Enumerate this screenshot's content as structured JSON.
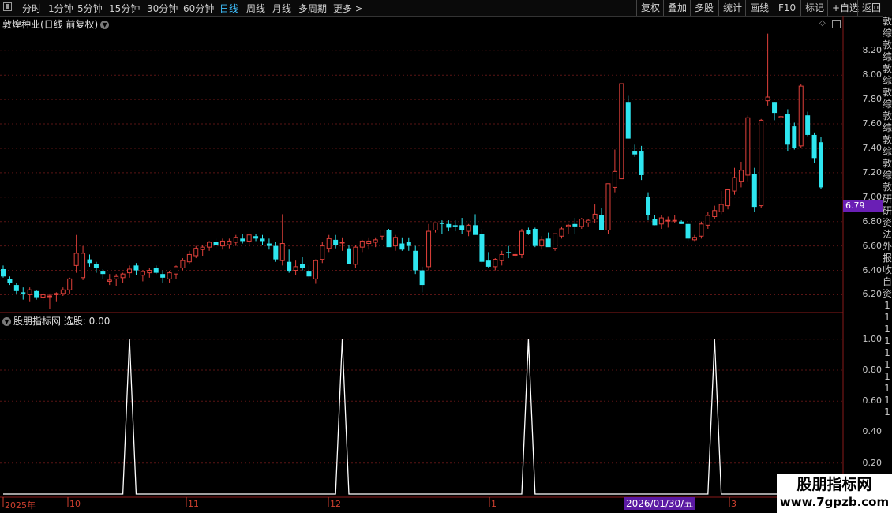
{
  "toolbar": {
    "periods": [
      {
        "label": "分时",
        "active": false
      },
      {
        "label": "1分钟",
        "active": false
      },
      {
        "label": "5分钟",
        "active": false
      },
      {
        "label": "15分钟",
        "active": false
      },
      {
        "label": "30分钟",
        "active": false
      },
      {
        "label": "60分钟",
        "active": false
      },
      {
        "label": "日线",
        "active": true
      },
      {
        "label": "周线",
        "active": false
      },
      {
        "label": "月线",
        "active": false
      },
      {
        "label": "多周期",
        "active": false
      },
      {
        "label": "更多 >",
        "active": false
      }
    ],
    "right": [
      "复权",
      "叠加",
      "多股",
      "统计",
      "画线",
      "F10",
      "标记",
      "+自选",
      "返回"
    ]
  },
  "main": {
    "title": "敦煌种业(日线 前复权)",
    "yticks": [
      "8.20",
      "8.00",
      "7.80",
      "7.60",
      "7.40",
      "7.20",
      "7.00",
      "6.80",
      "6.60",
      "6.40",
      "6.20"
    ],
    "last_price": "6.79",
    "colors": {
      "up": "#e0403a",
      "down": "#2ee6f0",
      "grid": "#5a1414",
      "accent": "#6a1fb5"
    }
  },
  "indicator": {
    "title": "股朋指标网 选股: 0.00",
    "yticks": [
      "1.00",
      "0.80",
      "0.60",
      "0.40",
      "0.20"
    ]
  },
  "xaxis": {
    "ticks": [
      "2025年",
      "10",
      "11",
      "12",
      "1",
      "3"
    ],
    "selected_date": "2026/01/30/五"
  },
  "side_chars": [
    "敦",
    "综",
    "敦",
    "综",
    "敦",
    "综",
    "敦",
    "综",
    "敦",
    "综",
    "敦",
    "综",
    "敦",
    "综",
    "敦",
    "研",
    "研",
    "资",
    "法",
    "外",
    "报",
    "收",
    "",
    "",
    "",
    "",
    "",
    "",
    "自",
    "资",
    "1",
    "1",
    "1",
    "1",
    "1",
    "1",
    "1",
    "1",
    "1",
    "1"
  ],
  "watermark": {
    "line1": "股朋指标网",
    "line2": "www.7gpzb.com"
  },
  "chart_data": [
    {
      "type": "candlestick",
      "title": "敦煌种业(日线 前复权)",
      "ylim": [
        6.08,
        8.37
      ],
      "yticks": [
        8.2,
        8.0,
        7.8,
        7.6,
        7.4,
        7.2,
        7.0,
        6.8,
        6.6,
        6.4,
        6.2
      ],
      "ohlc": [
        [
          6.41,
          6.44,
          6.34,
          6.35
        ],
        [
          6.33,
          6.35,
          6.28,
          6.3
        ],
        [
          6.28,
          6.3,
          6.21,
          6.23
        ],
        [
          6.22,
          6.26,
          6.16,
          6.21
        ],
        [
          6.2,
          6.26,
          6.14,
          6.24
        ],
        [
          6.23,
          6.24,
          6.16,
          6.18
        ],
        [
          6.18,
          6.22,
          6.15,
          6.2
        ],
        [
          6.19,
          6.21,
          6.08,
          6.19
        ],
        [
          6.2,
          6.22,
          6.14,
          6.21
        ],
        [
          6.21,
          6.26,
          6.19,
          6.24
        ],
        [
          6.24,
          6.34,
          6.21,
          6.33
        ],
        [
          6.44,
          6.69,
          6.38,
          6.54
        ],
        [
          6.34,
          6.6,
          6.32,
          6.54
        ],
        [
          6.49,
          6.53,
          6.43,
          6.46
        ],
        [
          6.45,
          6.47,
          6.38,
          6.42
        ],
        [
          6.39,
          6.41,
          6.33,
          6.37
        ],
        [
          6.31,
          6.37,
          6.28,
          6.32
        ],
        [
          6.33,
          6.37,
          6.27,
          6.35
        ],
        [
          6.34,
          6.38,
          6.3,
          6.37
        ],
        [
          6.38,
          6.44,
          6.34,
          6.41
        ],
        [
          6.44,
          6.46,
          6.36,
          6.4
        ],
        [
          6.36,
          6.4,
          6.31,
          6.39
        ],
        [
          6.38,
          6.42,
          6.34,
          6.4
        ],
        [
          6.42,
          6.44,
          6.37,
          6.38
        ],
        [
          6.37,
          6.4,
          6.3,
          6.34
        ],
        [
          6.33,
          6.39,
          6.3,
          6.38
        ],
        [
          6.37,
          6.44,
          6.33,
          6.43
        ],
        [
          6.42,
          6.5,
          6.4,
          6.48
        ],
        [
          6.47,
          6.56,
          6.45,
          6.53
        ],
        [
          6.52,
          6.6,
          6.5,
          6.58
        ],
        [
          6.57,
          6.61,
          6.52,
          6.59
        ],
        [
          6.59,
          6.64,
          6.56,
          6.63
        ],
        [
          6.63,
          6.66,
          6.58,
          6.61
        ],
        [
          6.6,
          6.66,
          6.57,
          6.64
        ],
        [
          6.61,
          6.66,
          6.58,
          6.64
        ],
        [
          6.63,
          6.69,
          6.6,
          6.67
        ],
        [
          6.66,
          6.7,
          6.62,
          6.64
        ],
        [
          6.64,
          6.69,
          6.6,
          6.69
        ],
        [
          6.68,
          6.7,
          6.64,
          6.66
        ],
        [
          6.66,
          6.69,
          6.61,
          6.64
        ],
        [
          6.62,
          6.66,
          6.57,
          6.6
        ],
        [
          6.6,
          6.63,
          6.47,
          6.49
        ],
        [
          6.48,
          6.86,
          6.44,
          6.62
        ],
        [
          6.47,
          6.57,
          6.38,
          6.39
        ],
        [
          6.4,
          6.48,
          6.36,
          6.43
        ],
        [
          6.45,
          6.51,
          6.4,
          6.42
        ],
        [
          6.39,
          6.44,
          6.33,
          6.35
        ],
        [
          6.33,
          6.49,
          6.29,
          6.48
        ],
        [
          6.49,
          6.63,
          6.46,
          6.6
        ],
        [
          6.58,
          6.69,
          6.55,
          6.66
        ],
        [
          6.65,
          6.69,
          6.58,
          6.61
        ],
        [
          6.63,
          6.67,
          6.56,
          6.63
        ],
        [
          6.58,
          6.61,
          6.47,
          6.45
        ],
        [
          6.45,
          6.61,
          6.42,
          6.59
        ],
        [
          6.59,
          6.65,
          6.55,
          6.64
        ],
        [
          6.62,
          6.67,
          6.57,
          6.64
        ],
        [
          6.63,
          6.67,
          6.59,
          6.65
        ],
        [
          6.68,
          6.73,
          6.65,
          6.73
        ],
        [
          6.73,
          6.74,
          6.6,
          6.59
        ],
        [
          6.6,
          6.69,
          6.56,
          6.67
        ],
        [
          6.62,
          6.67,
          6.56,
          6.57
        ],
        [
          6.63,
          6.67,
          6.56,
          6.6
        ],
        [
          6.56,
          6.6,
          6.37,
          6.4
        ],
        [
          6.4,
          6.43,
          6.22,
          6.28
        ],
        [
          6.43,
          6.78,
          6.4,
          6.72
        ],
        [
          6.73,
          6.79,
          6.71,
          6.79
        ],
        [
          6.79,
          6.81,
          6.7,
          6.78
        ],
        [
          6.78,
          6.81,
          6.72,
          6.75
        ],
        [
          6.77,
          6.81,
          6.72,
          6.76
        ],
        [
          6.77,
          6.83,
          6.7,
          6.73
        ],
        [
          6.72,
          6.78,
          6.68,
          6.77
        ],
        [
          6.77,
          6.86,
          6.71,
          6.69
        ],
        [
          6.7,
          6.74,
          6.46,
          6.47
        ],
        [
          6.48,
          6.55,
          6.42,
          6.43
        ],
        [
          6.43,
          6.5,
          6.4,
          6.49
        ],
        [
          6.48,
          6.56,
          6.44,
          6.53
        ],
        [
          6.55,
          6.6,
          6.5,
          6.54
        ],
        [
          6.53,
          6.62,
          6.5,
          6.53
        ],
        [
          6.53,
          6.74,
          6.5,
          6.72
        ],
        [
          6.73,
          6.75,
          6.69,
          6.7
        ],
        [
          6.74,
          6.75,
          6.59,
          6.6
        ],
        [
          6.6,
          6.68,
          6.57,
          6.65
        ],
        [
          6.66,
          6.71,
          6.6,
          6.59
        ],
        [
          6.58,
          6.7,
          6.56,
          6.7
        ],
        [
          6.68,
          6.76,
          6.66,
          6.74
        ],
        [
          6.76,
          6.78,
          6.7,
          6.77
        ],
        [
          6.78,
          6.83,
          6.7,
          6.76
        ],
        [
          6.76,
          6.83,
          6.74,
          6.82
        ],
        [
          6.79,
          6.82,
          6.76,
          6.81
        ],
        [
          6.82,
          6.94,
          6.79,
          6.86
        ],
        [
          6.85,
          6.91,
          6.77,
          6.73
        ],
        [
          6.73,
          7.1,
          6.7,
          7.11
        ],
        [
          7.08,
          7.39,
          7.04,
          7.21
        ],
        [
          7.15,
          7.92,
          7.18,
          7.93
        ],
        [
          7.78,
          7.83,
          7.48,
          7.48
        ],
        [
          7.38,
          7.43,
          7.33,
          7.35
        ],
        [
          7.38,
          7.42,
          7.14,
          7.18
        ],
        [
          7.0,
          7.04,
          6.81,
          6.85
        ],
        [
          6.82,
          6.85,
          6.77,
          6.77
        ],
        [
          6.78,
          6.85,
          6.74,
          6.83
        ],
        [
          6.81,
          6.84,
          6.75,
          6.81
        ],
        [
          6.81,
          6.85,
          6.79,
          6.81
        ],
        [
          6.8,
          6.81,
          6.78,
          6.78
        ],
        [
          6.78,
          6.79,
          6.64,
          6.66
        ],
        [
          6.65,
          6.69,
          6.64,
          6.67
        ],
        [
          6.68,
          6.8,
          6.66,
          6.78
        ],
        [
          6.77,
          6.88,
          6.74,
          6.85
        ],
        [
          6.84,
          6.93,
          6.82,
          6.89
        ],
        [
          6.88,
          7.05,
          6.86,
          6.94
        ],
        [
          6.93,
          7.07,
          6.9,
          7.06
        ],
        [
          7.05,
          7.24,
          7.02,
          7.16
        ],
        [
          7.13,
          7.29,
          7.08,
          7.22
        ],
        [
          7.18,
          7.67,
          7.13,
          7.65
        ],
        [
          7.19,
          7.24,
          6.88,
          6.92
        ],
        [
          6.93,
          7.64,
          6.91,
          7.63
        ],
        [
          7.79,
          8.34,
          7.75,
          7.82
        ],
        [
          7.78,
          7.78,
          7.63,
          7.69
        ],
        [
          7.65,
          7.68,
          7.57,
          7.66
        ],
        [
          7.68,
          7.72,
          7.38,
          7.43
        ],
        [
          7.58,
          7.61,
          7.39,
          7.4
        ],
        [
          7.42,
          7.93,
          7.4,
          7.91
        ],
        [
          7.67,
          7.7,
          7.5,
          7.51
        ],
        [
          7.51,
          7.53,
          7.28,
          7.32
        ],
        [
          7.45,
          7.49,
          7.07,
          7.08
        ]
      ]
    },
    {
      "type": "line",
      "title": "股朋指标网 选股: 0.00",
      "ylim": [
        0,
        1.07
      ],
      "yticks": [
        1.0,
        0.8,
        0.6,
        0.4,
        0.2
      ],
      "signal_bar_indices": [
        19,
        51,
        79,
        107
      ],
      "bar_count": 124
    }
  ]
}
